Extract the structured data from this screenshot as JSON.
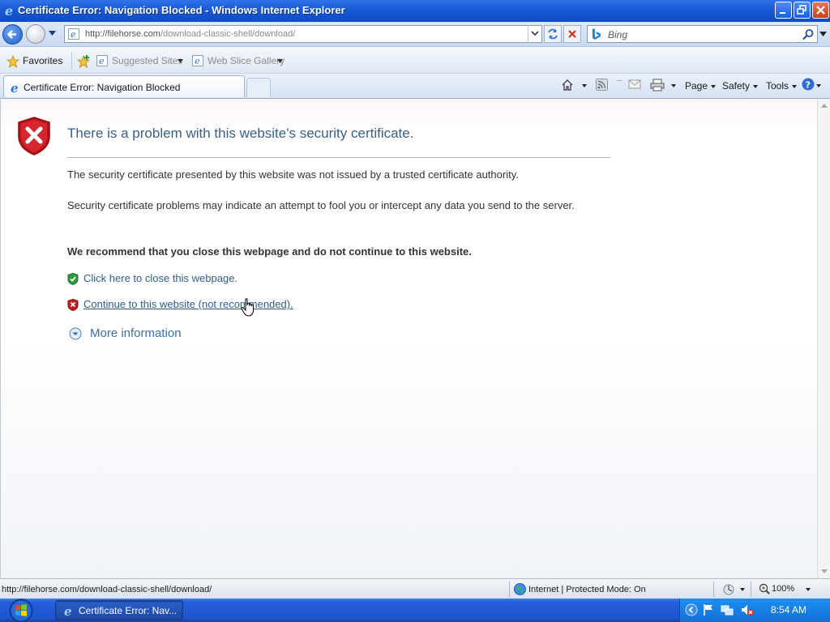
{
  "window": {
    "title": "Certificate Error: Navigation Blocked - Windows Internet Explorer"
  },
  "address_bar": {
    "url_host": "http://filehorse.com",
    "url_path": "/download-classic-shell/download/"
  },
  "search": {
    "placeholder": "Bing"
  },
  "favorites_bar": {
    "favorites_label": "Favorites",
    "suggested_sites_label": "Suggested Sites",
    "web_slice_gallery_label": "Web Slice Gallery"
  },
  "tab": {
    "title": "Certificate Error: Navigation Blocked"
  },
  "command_bar": {
    "page_label": "Page",
    "safety_label": "Safety",
    "tools_label": "Tools"
  },
  "content": {
    "heading": "There is a problem with this website's security certificate.",
    "paragraph1": "The security certificate presented by this website was not issued by a trusted certificate authority.",
    "paragraph2": "Security certificate problems may indicate an attempt to fool you or intercept any data you send to the server.",
    "recommendation": "We recommend that you close this webpage and do not continue to this website.",
    "close_link": "Click here to close this webpage.",
    "continue_link": "Continue to this website (not recommended).",
    "more_info": "More information"
  },
  "status_bar": {
    "url": "http://filehorse.com/download-classic-shell/download/",
    "zone": "Internet | Protected Mode: On",
    "zoom": "100%"
  },
  "taskbar": {
    "task_label": "Certificate Error: Nav...",
    "clock": "8:54 AM"
  },
  "colors": {
    "titlebar": "#1a5ad6",
    "heading": "#3a5f86",
    "link": "#2f5c8a",
    "taskbar": "#245edb"
  }
}
